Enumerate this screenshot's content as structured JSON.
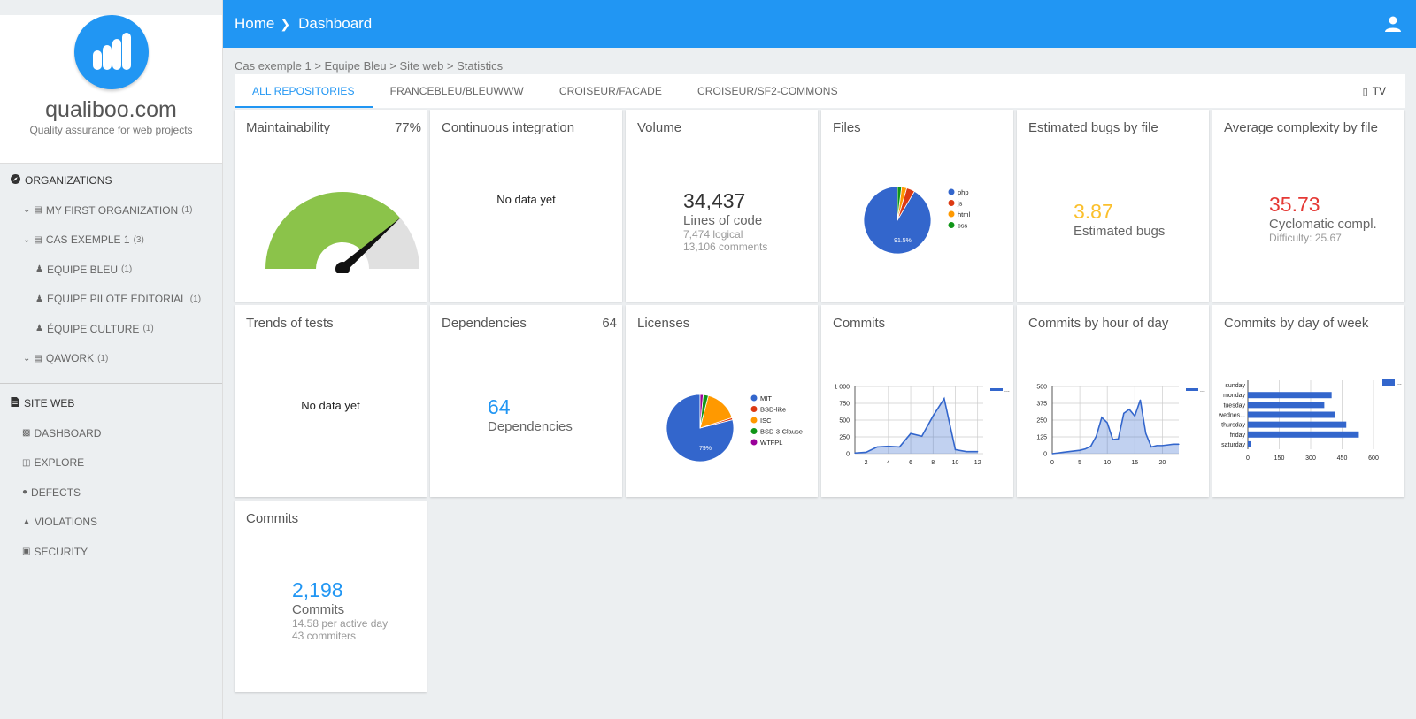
{
  "brand": {
    "name": "qualiboo.com",
    "tagline": "Quality assurance for web projects"
  },
  "sidebar": {
    "organizations_label": "ORGANIZATIONS",
    "orgs": [
      {
        "label": "MY FIRST ORGANIZATION",
        "count": "(1)"
      },
      {
        "label": "CAS EXEMPLE 1",
        "count": "(3)"
      },
      {
        "label": "EQUIPE BLEU",
        "count": "(1)"
      },
      {
        "label": "EQUIPE PILOTE ÉDITORIAL",
        "count": "(1)"
      },
      {
        "label": "ÉQUIPE CULTURE",
        "count": "(1)"
      },
      {
        "label": "QAWORK",
        "count": "(1)"
      }
    ],
    "site_label": "SITE WEB",
    "site_items": [
      "DASHBOARD",
      "EXPLORE",
      "DEFECTS",
      "VIOLATIONS",
      "SECURITY"
    ]
  },
  "header": {
    "home": "Home",
    "current": "Dashboard"
  },
  "path": "Cas exemple 1 > Equipe Bleu > Site web > Statistics",
  "tabs": [
    "ALL REPOSITORIES",
    "FRANCEBLEU/BLEUWWW",
    "CROISEUR/FACADE",
    "CROISEUR/SF2-COMMONS"
  ],
  "tv_label": "TV",
  "cards": {
    "maintainability": {
      "title": "Maintainability",
      "value": "77%",
      "percent": 77
    },
    "ci": {
      "title": "Continuous integration",
      "nodata": "No data yet"
    },
    "volume": {
      "title": "Volume",
      "number": "34,437",
      "label": "Lines of code",
      "sub1": "7,474 logical",
      "sub2": "13,106 comments"
    },
    "files": {
      "title": "Files"
    },
    "bugs": {
      "title": "Estimated bugs by file",
      "number": "3.87",
      "label": "Estimated bugs"
    },
    "complexity": {
      "title": "Average complexity by file",
      "number": "35.73",
      "label": "Cyclomatic compl.",
      "sub": "Difficulty: 25.67"
    },
    "tests": {
      "title": "Trends of tests",
      "nodata": "No data yet"
    },
    "deps": {
      "title": "Dependencies",
      "value": "64",
      "number": "64",
      "label": "Dependencies"
    },
    "licenses": {
      "title": "Licenses"
    },
    "commits_chart": {
      "title": "Commits"
    },
    "by_hour": {
      "title": "Commits by hour of day"
    },
    "by_day": {
      "title": "Commits by day of week"
    },
    "commits": {
      "title": "Commits",
      "number": "2,198",
      "label": "Commits",
      "sub1": "14.58 per active day",
      "sub2": "43 commiters"
    }
  },
  "colors": {
    "primary": "#2196f3",
    "gauge_green": "#8bc34a",
    "bugs": "#fbc02d",
    "complexity": "#e53935",
    "series": "#3366cc"
  },
  "chart_data": [
    {
      "type": "pie",
      "id": "files",
      "labels": [
        "php",
        "js",
        "html",
        "css"
      ],
      "values": [
        91.5,
        4.0,
        2.5,
        2.0
      ],
      "colors": [
        "#3366cc",
        "#dc3912",
        "#ff9900",
        "#109618"
      ],
      "slice_label": "91.5%"
    },
    {
      "type": "pie",
      "id": "licenses",
      "labels": [
        "MIT",
        "BSD-like",
        "ISC",
        "BSD-3-Clause",
        "WTFPL"
      ],
      "values": [
        79,
        1,
        16,
        2.5,
        1.5
      ],
      "colors": [
        "#3366cc",
        "#dc3912",
        "#ff9900",
        "#109618",
        "#990099"
      ],
      "slice_label": "79%"
    },
    {
      "type": "area",
      "id": "commits",
      "x": [
        1,
        2,
        3,
        4,
        5,
        6,
        7,
        8,
        9,
        10,
        11,
        12
      ],
      "values": [
        10,
        20,
        100,
        110,
        100,
        300,
        260,
        560,
        820,
        60,
        30,
        30
      ],
      "xticks": [
        2,
        4,
        6,
        8,
        10,
        12
      ],
      "xticklabels": [
        "2",
        "4",
        "6",
        "8",
        "10",
        "12"
      ],
      "yticks": [
        0,
        250,
        500,
        750,
        1000
      ],
      "yticklabels": [
        "0",
        "250",
        "500",
        "750",
        "1 000"
      ],
      "xlim": [
        1,
        12.5
      ],
      "ylim": [
        0,
        1000
      ],
      "legend": "..."
    },
    {
      "type": "area",
      "id": "by_hour",
      "x": [
        0,
        1,
        2,
        3,
        4,
        5,
        6,
        7,
        8,
        9,
        10,
        11,
        12,
        13,
        14,
        15,
        16,
        17,
        18,
        19,
        20,
        21,
        22,
        23
      ],
      "values": [
        0,
        5,
        10,
        15,
        20,
        25,
        35,
        55,
        130,
        270,
        230,
        105,
        110,
        300,
        330,
        280,
        400,
        150,
        50,
        60,
        60,
        65,
        70,
        70
      ],
      "xticks": [
        0,
        5,
        10,
        15,
        20
      ],
      "xticklabels": [
        "0",
        "5",
        "10",
        "15",
        "20"
      ],
      "yticks": [
        0,
        125,
        250,
        375,
        500
      ],
      "yticklabels": [
        "0",
        "125",
        "250",
        "375",
        "500"
      ],
      "xlim": [
        0,
        23
      ],
      "ylim": [
        0,
        500
      ],
      "legend": "..."
    },
    {
      "type": "bar",
      "id": "by_day",
      "orientation": "horizontal",
      "categories": [
        "sunday",
        "monday",
        "tuesday",
        "wednes...",
        "thursday",
        "friday",
        "saturday"
      ],
      "values": [
        0,
        400,
        365,
        415,
        470,
        530,
        15
      ],
      "xticks": [
        0,
        150,
        300,
        450,
        600
      ],
      "xticklabels": [
        "0",
        "150",
        "300",
        "450",
        "600"
      ],
      "xlim": [
        0,
        600
      ],
      "legend": "..."
    }
  ]
}
